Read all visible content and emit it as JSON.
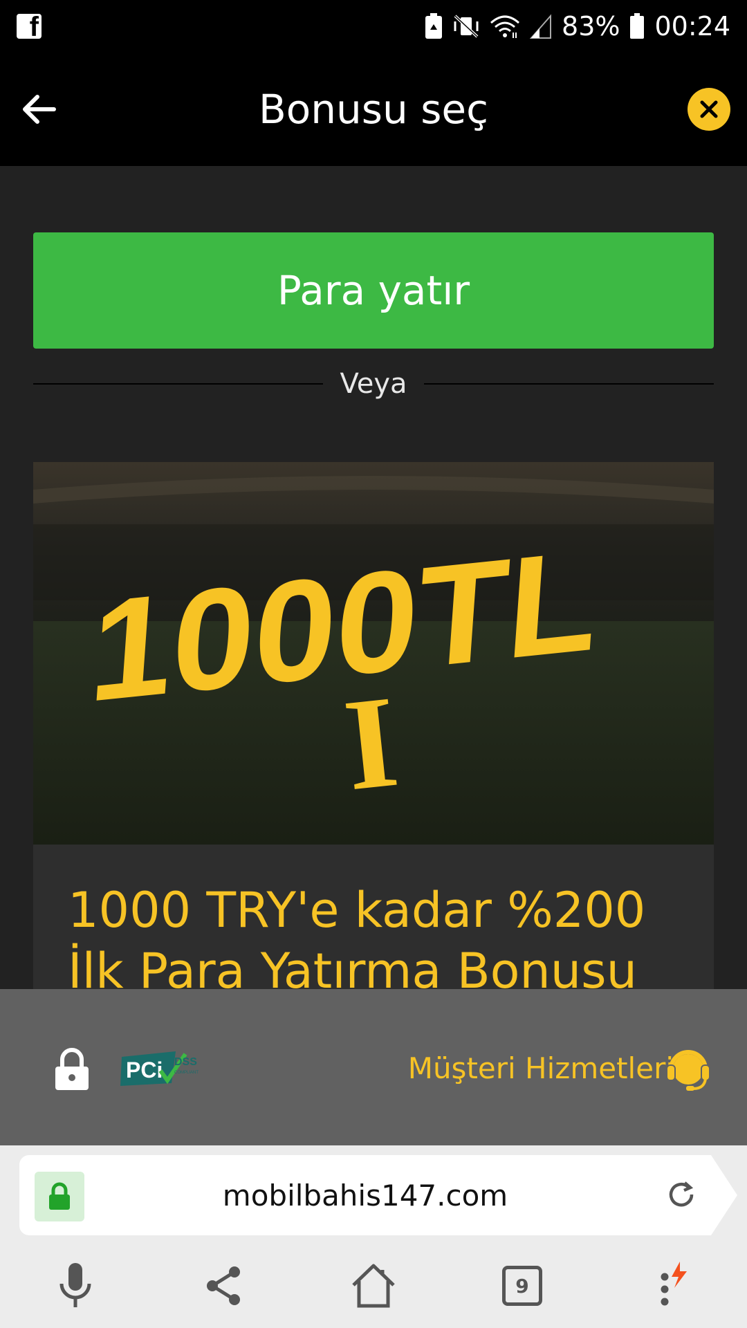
{
  "status_bar": {
    "battery_percent": "83%",
    "time": "00:24",
    "icons": [
      "facebook-icon",
      "recycle-icon",
      "vibrate-off-icon",
      "wifi-icon",
      "signal-icon",
      "battery-icon"
    ]
  },
  "header": {
    "title": "Bonusu seç",
    "close_color": "#f7c325"
  },
  "deposit": {
    "label": "Para yatır",
    "color": "#3db944"
  },
  "divider": {
    "label": "Veya"
  },
  "bonus": {
    "banner_amount": "1000TL",
    "banner_mark": "I",
    "title": "1000 TRY'e kadar %200 İlk Para Yatırma Bonusu",
    "accent": "#f7c325"
  },
  "footer": {
    "pci_main": "PCi",
    "pci_dss": "DSS",
    "pci_sub": "COMPLIANT",
    "support_label": "Müşteri Hizmetleri"
  },
  "browser": {
    "url": "mobilbahis147.com",
    "tab_count": "9"
  }
}
